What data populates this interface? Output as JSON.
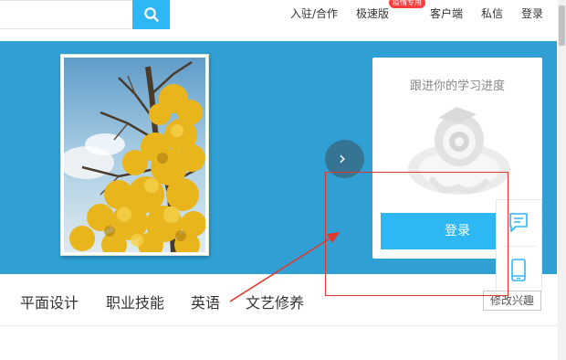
{
  "header": {
    "nav": [
      {
        "label": "入驻/合作"
      },
      {
        "label": "极速版"
      },
      {
        "label": "客户端"
      },
      {
        "label": "私信"
      },
      {
        "label": "登录"
      }
    ],
    "speed_badge": "疫情专用"
  },
  "banner": {
    "login_card": {
      "progress_text": "跟进你的学习进度",
      "login_label": "登录"
    },
    "next_arrow_glyph": "›"
  },
  "categories": [
    {
      "label": "平面设计"
    },
    {
      "label": "职业技能"
    },
    {
      "label": "英语"
    },
    {
      "label": "文艺修养"
    }
  ],
  "modify_interest_label": "修改兴趣",
  "icons": {
    "search": "search-icon",
    "next": "chevron-right-icon",
    "mascot": "mascot-icon",
    "message": "message-icon",
    "mobile": "mobile-phone-icon"
  },
  "colors": {
    "banner_bg": "#30a0d4",
    "accent": "#2db7f5",
    "badge": "#ff3d3d",
    "annotation": "#e0382b"
  }
}
